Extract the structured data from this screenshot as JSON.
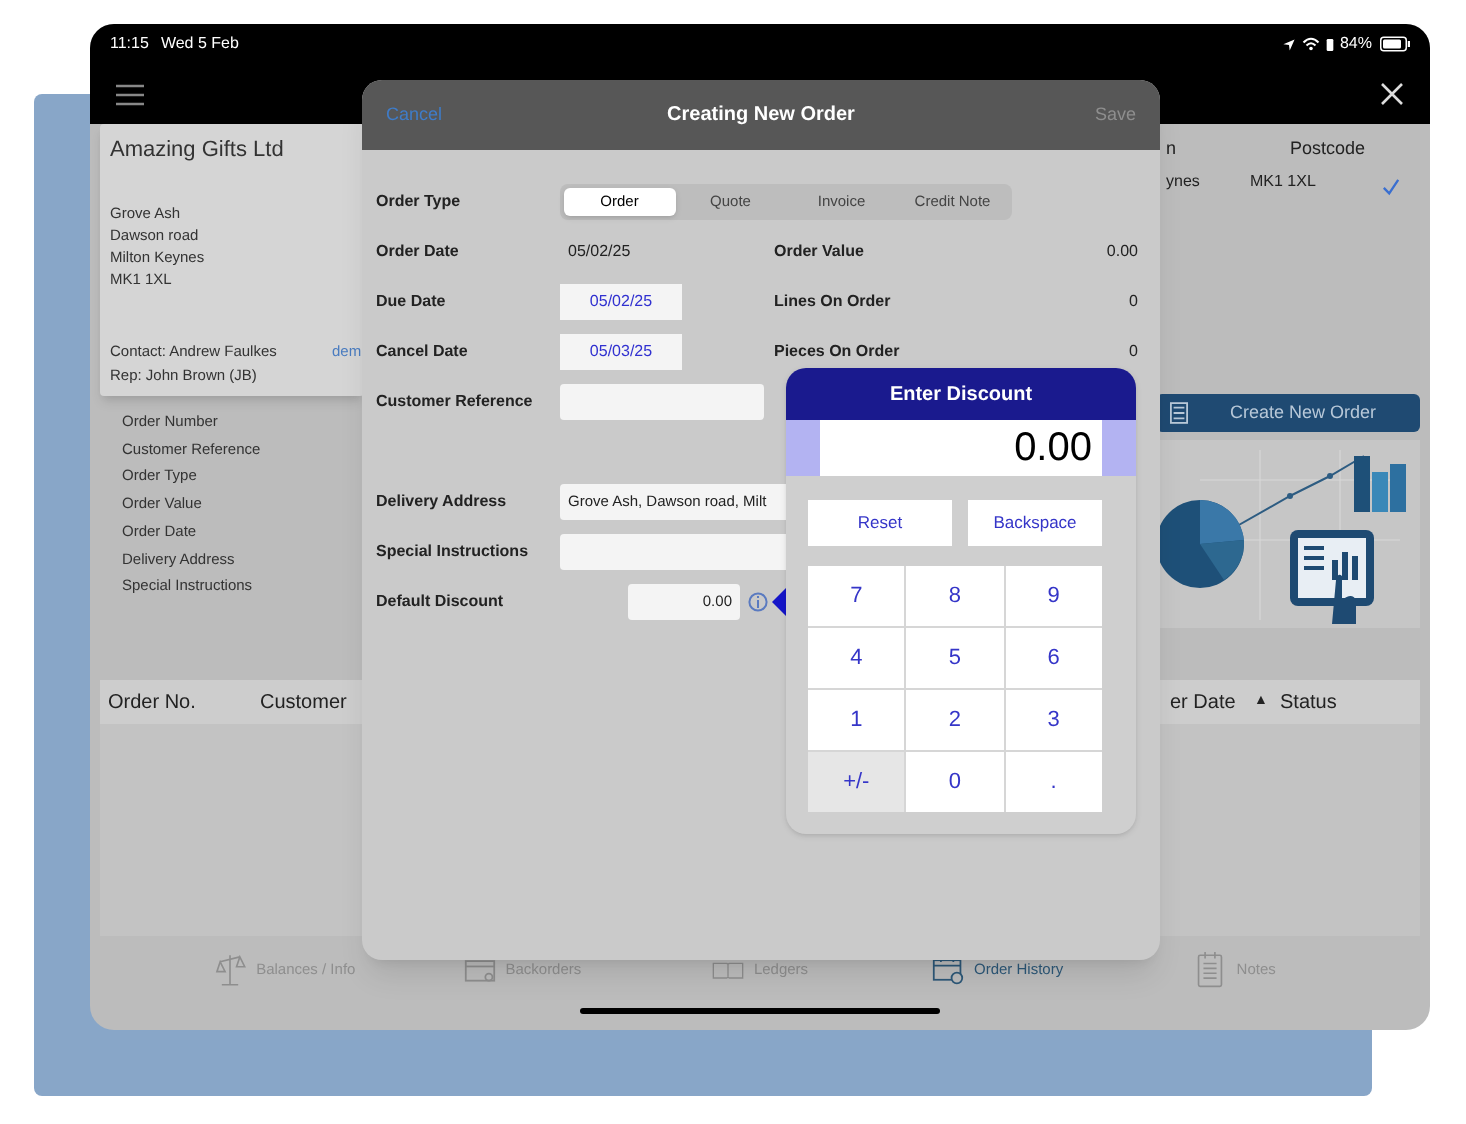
{
  "status_bar": {
    "time": "11:15",
    "date": "Wed 5 Feb",
    "battery": "84%"
  },
  "customer_card": {
    "name": "Amazing Gifts Ltd",
    "address": [
      "Grove Ash",
      "Dawson road",
      "Milton Keynes",
      "MK1 1XL"
    ],
    "contact": "Contact: Andrew Faulkes",
    "rep": "Rep: John Brown (JB)",
    "link": "dem"
  },
  "order_fields": [
    "Order Number",
    "Customer Reference",
    "Order Type",
    "Order Value",
    "Order Date",
    "Delivery Address",
    "Special Instructions"
  ],
  "address_table": {
    "columns": [
      "n",
      "Postcode"
    ],
    "rows": [
      {
        "cells": [
          "ynes",
          "MK1 1XL"
        ],
        "checked": true
      }
    ]
  },
  "create_button": "Create New Order",
  "orders_table": {
    "columns": [
      {
        "label": "Order No."
      },
      {
        "label": "Customer"
      },
      {
        "label": "er Date",
        "sort_indicator": "▲"
      },
      {
        "label": "Status"
      }
    ]
  },
  "tab_bar": [
    {
      "label": "Balances / Info",
      "kind": "scales",
      "selected": false
    },
    {
      "label": "Backorders",
      "kind": "box",
      "selected": false
    },
    {
      "label": "Ledgers",
      "kind": "book",
      "selected": false
    },
    {
      "label": "Order History",
      "kind": "calendar",
      "selected": true
    },
    {
      "label": "Notes",
      "kind": "notepad",
      "selected": false
    }
  ],
  "modal": {
    "cancel": "Cancel",
    "title": "Creating New Order",
    "save": {
      "label": "Save",
      "disabled": true
    },
    "order_type": {
      "label": "Order Type",
      "options": [
        {
          "label": "Order",
          "selected": true
        },
        {
          "label": "Quote",
          "selected": false
        },
        {
          "label": "Invoice",
          "selected": false
        },
        {
          "label": "Credit Note",
          "selected": false
        }
      ]
    },
    "fields": [
      {
        "label": "Order Date",
        "kind": "text",
        "value": "05/02/25"
      },
      {
        "label": "Due Date",
        "kind": "date",
        "value": "05/02/25"
      },
      {
        "label": "Cancel Date",
        "kind": "date",
        "value": "05/03/25"
      },
      {
        "label": "Customer Reference",
        "kind": "input"
      },
      {
        "label": "Delivery Address",
        "kind": "wide",
        "value": "Grove Ash, Dawson road, Milt"
      },
      {
        "label": "Special Instructions",
        "kind": "wide"
      },
      {
        "label": "Default Discount",
        "kind": "discount",
        "value": "0.00"
      }
    ],
    "totals": [
      {
        "label": "Order Value",
        "value": "0.00"
      },
      {
        "label": "Lines On Order",
        "value": "0"
      },
      {
        "label": "Pieces On Order",
        "value": "0"
      }
    ]
  },
  "discount_popup": {
    "title": "Enter Discount",
    "value": "0.00",
    "actions": [
      "Reset",
      "Backspace"
    ],
    "keys": [
      {
        "label": "7",
        "kind": "digit"
      },
      {
        "label": "8",
        "kind": "digit"
      },
      {
        "label": "9",
        "kind": "digit"
      },
      {
        "label": "4",
        "kind": "digit"
      },
      {
        "label": "5",
        "kind": "digit"
      },
      {
        "label": "6",
        "kind": "digit"
      },
      {
        "label": "1",
        "kind": "digit"
      },
      {
        "label": "2",
        "kind": "digit"
      },
      {
        "label": "3",
        "kind": "digit"
      },
      {
        "label": "+/-",
        "kind": "sign"
      },
      {
        "label": "0",
        "kind": "digit"
      },
      {
        "label": ".",
        "kind": "digit"
      }
    ]
  }
}
